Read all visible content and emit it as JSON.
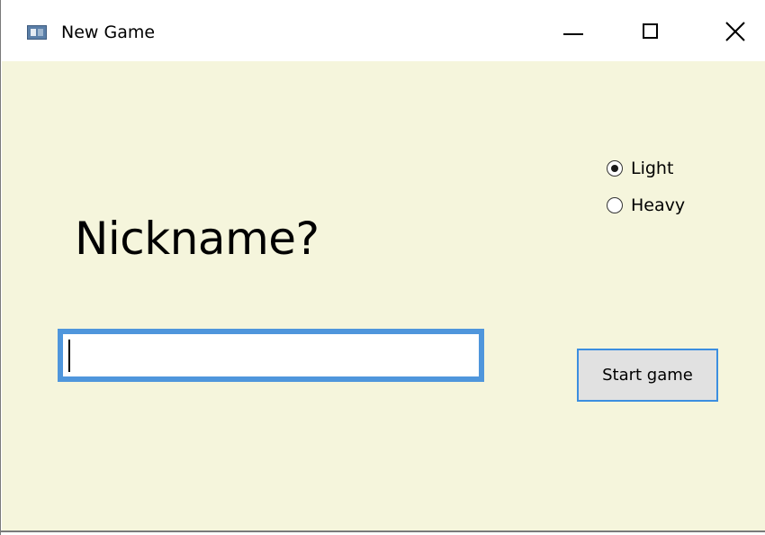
{
  "window": {
    "title": "New Game"
  },
  "form": {
    "heading": "Nickname?",
    "nickname": {
      "value": "",
      "placeholder": ""
    },
    "weight_options": [
      {
        "label": "Light",
        "checked": true
      },
      {
        "label": "Heavy",
        "checked": false
      }
    ],
    "start_label": "Start game"
  },
  "colors": {
    "client_background": "#f5f5dc",
    "focus_border": "#4f96dc",
    "button_face": "#e1e1e1"
  },
  "icons": {
    "app": "window-app-icon",
    "minimize": "minimize-icon",
    "maximize": "maximize-icon",
    "close": "close-icon"
  }
}
